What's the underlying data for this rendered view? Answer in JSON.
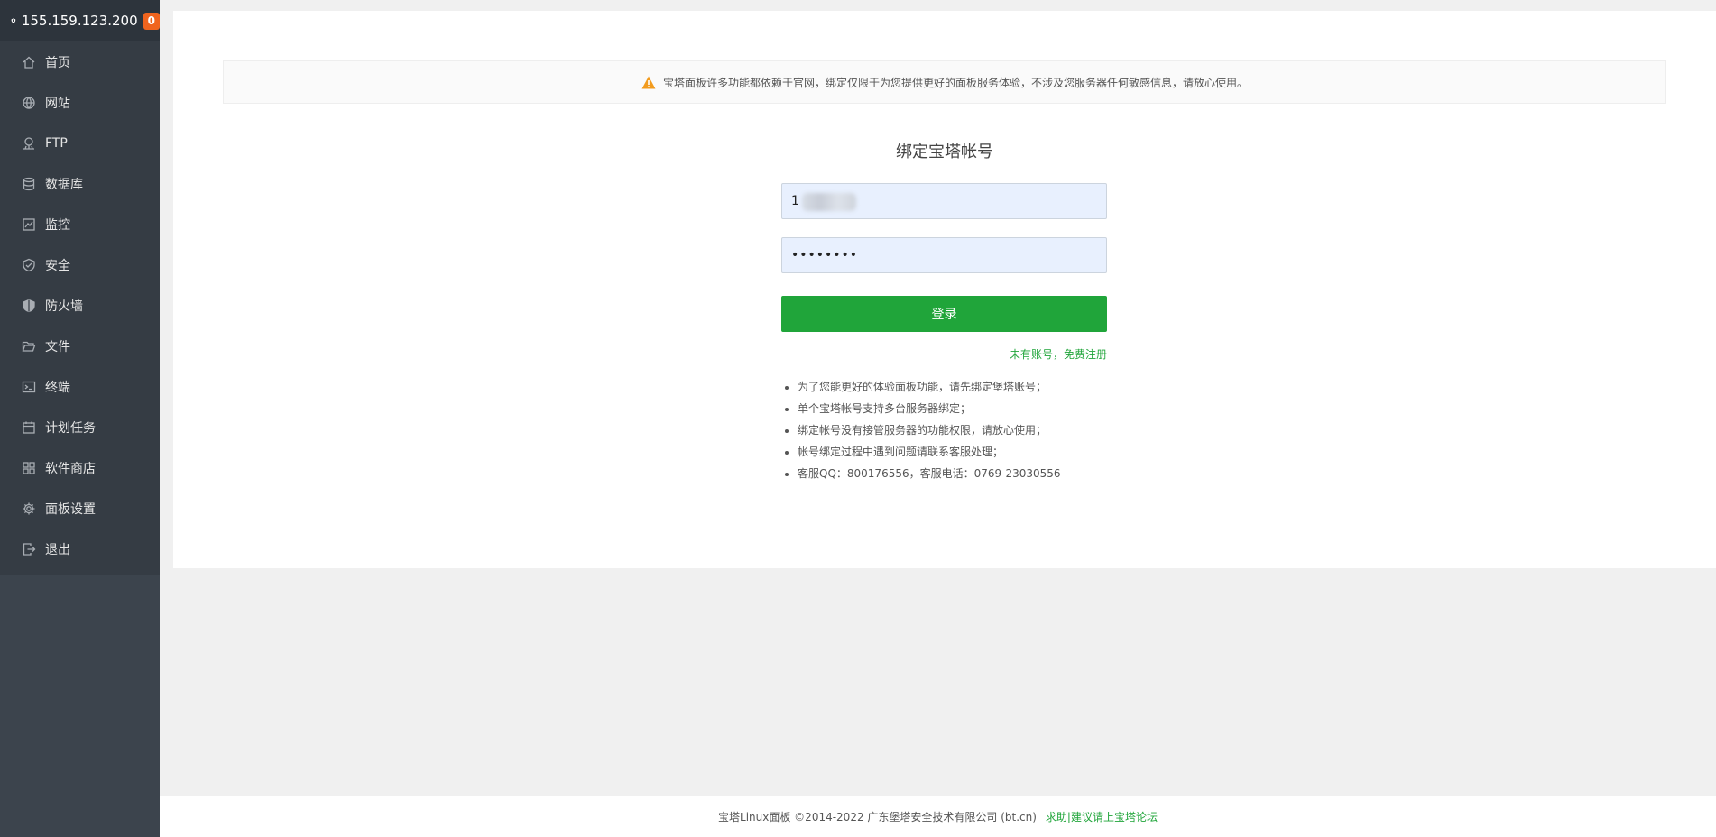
{
  "sidebar": {
    "server_ip": "155.159.123.200",
    "badge_count": "0",
    "items": [
      {
        "label": "首页",
        "icon": "home-icon"
      },
      {
        "label": "网站",
        "icon": "globe-icon"
      },
      {
        "label": "FTP",
        "icon": "ftp-icon"
      },
      {
        "label": "数据库",
        "icon": "database-icon"
      },
      {
        "label": "监控",
        "icon": "monitor-icon"
      },
      {
        "label": "安全",
        "icon": "shield-check-icon"
      },
      {
        "label": "防火墙",
        "icon": "firewall-icon"
      },
      {
        "label": "文件",
        "icon": "folder-icon"
      },
      {
        "label": "终端",
        "icon": "terminal-icon"
      },
      {
        "label": "计划任务",
        "icon": "calendar-icon"
      },
      {
        "label": "软件商店",
        "icon": "grid-icon"
      },
      {
        "label": "面板设置",
        "icon": "gear-icon"
      },
      {
        "label": "退出",
        "icon": "logout-icon"
      }
    ]
  },
  "main": {
    "notice": "宝塔面板许多功能都依赖于官网，绑定仅限于为您提供更好的面板服务体验，不涉及您服务器任何敏感信息，请放心使用。",
    "title": "绑定宝塔帐号",
    "username_value": "1",
    "password_value": "••••••••",
    "login_label": "登录",
    "register_label": "未有账号，免费注册",
    "tips": [
      "为了您能更好的体验面板功能，请先绑定堡塔账号；",
      "单个宝塔帐号支持多台服务器绑定；",
      "绑定帐号没有接管服务器的功能权限，请放心使用；",
      "帐号绑定过程中遇到问题请联系客服处理；",
      "客服QQ：800176556，客服电话：0769-23030556"
    ]
  },
  "footer": {
    "copyright": "宝塔Linux面板 ©2014-2022 广东堡塔安全技术有限公司 (bt.cn)",
    "link": "求助|建议请上宝塔论坛"
  },
  "colors": {
    "sidebar_bg": "#3c444d",
    "accent_green": "#20a53a",
    "badge_orange": "#f0641e"
  }
}
